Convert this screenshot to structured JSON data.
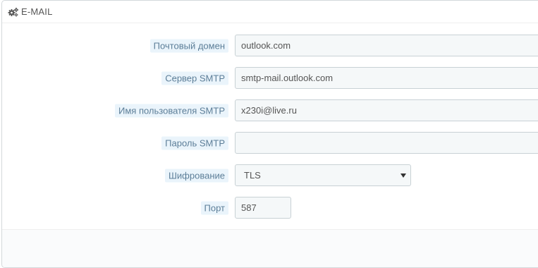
{
  "panel": {
    "title": "E-MAIL",
    "icon": "gears-icon"
  },
  "fields": {
    "mail_domain": {
      "label": "Почтовый домен",
      "value": "outlook.com"
    },
    "smtp_server": {
      "label": "Сервер SMTP",
      "value": "smtp-mail.outlook.com"
    },
    "smtp_username": {
      "label": "Имя пользователя SMTP",
      "value": "x230i@live.ru"
    },
    "smtp_password": {
      "label": "Пароль SMTP",
      "value": ""
    },
    "encryption": {
      "label": "Шифрование",
      "value": "TLS"
    },
    "port": {
      "label": "Порт",
      "value": "587"
    }
  },
  "colors": {
    "label_bg": "#eaf4fb",
    "label_text": "#5c7e98",
    "input_bg": "#f5f8f9",
    "input_border": "#c8d1d5"
  }
}
